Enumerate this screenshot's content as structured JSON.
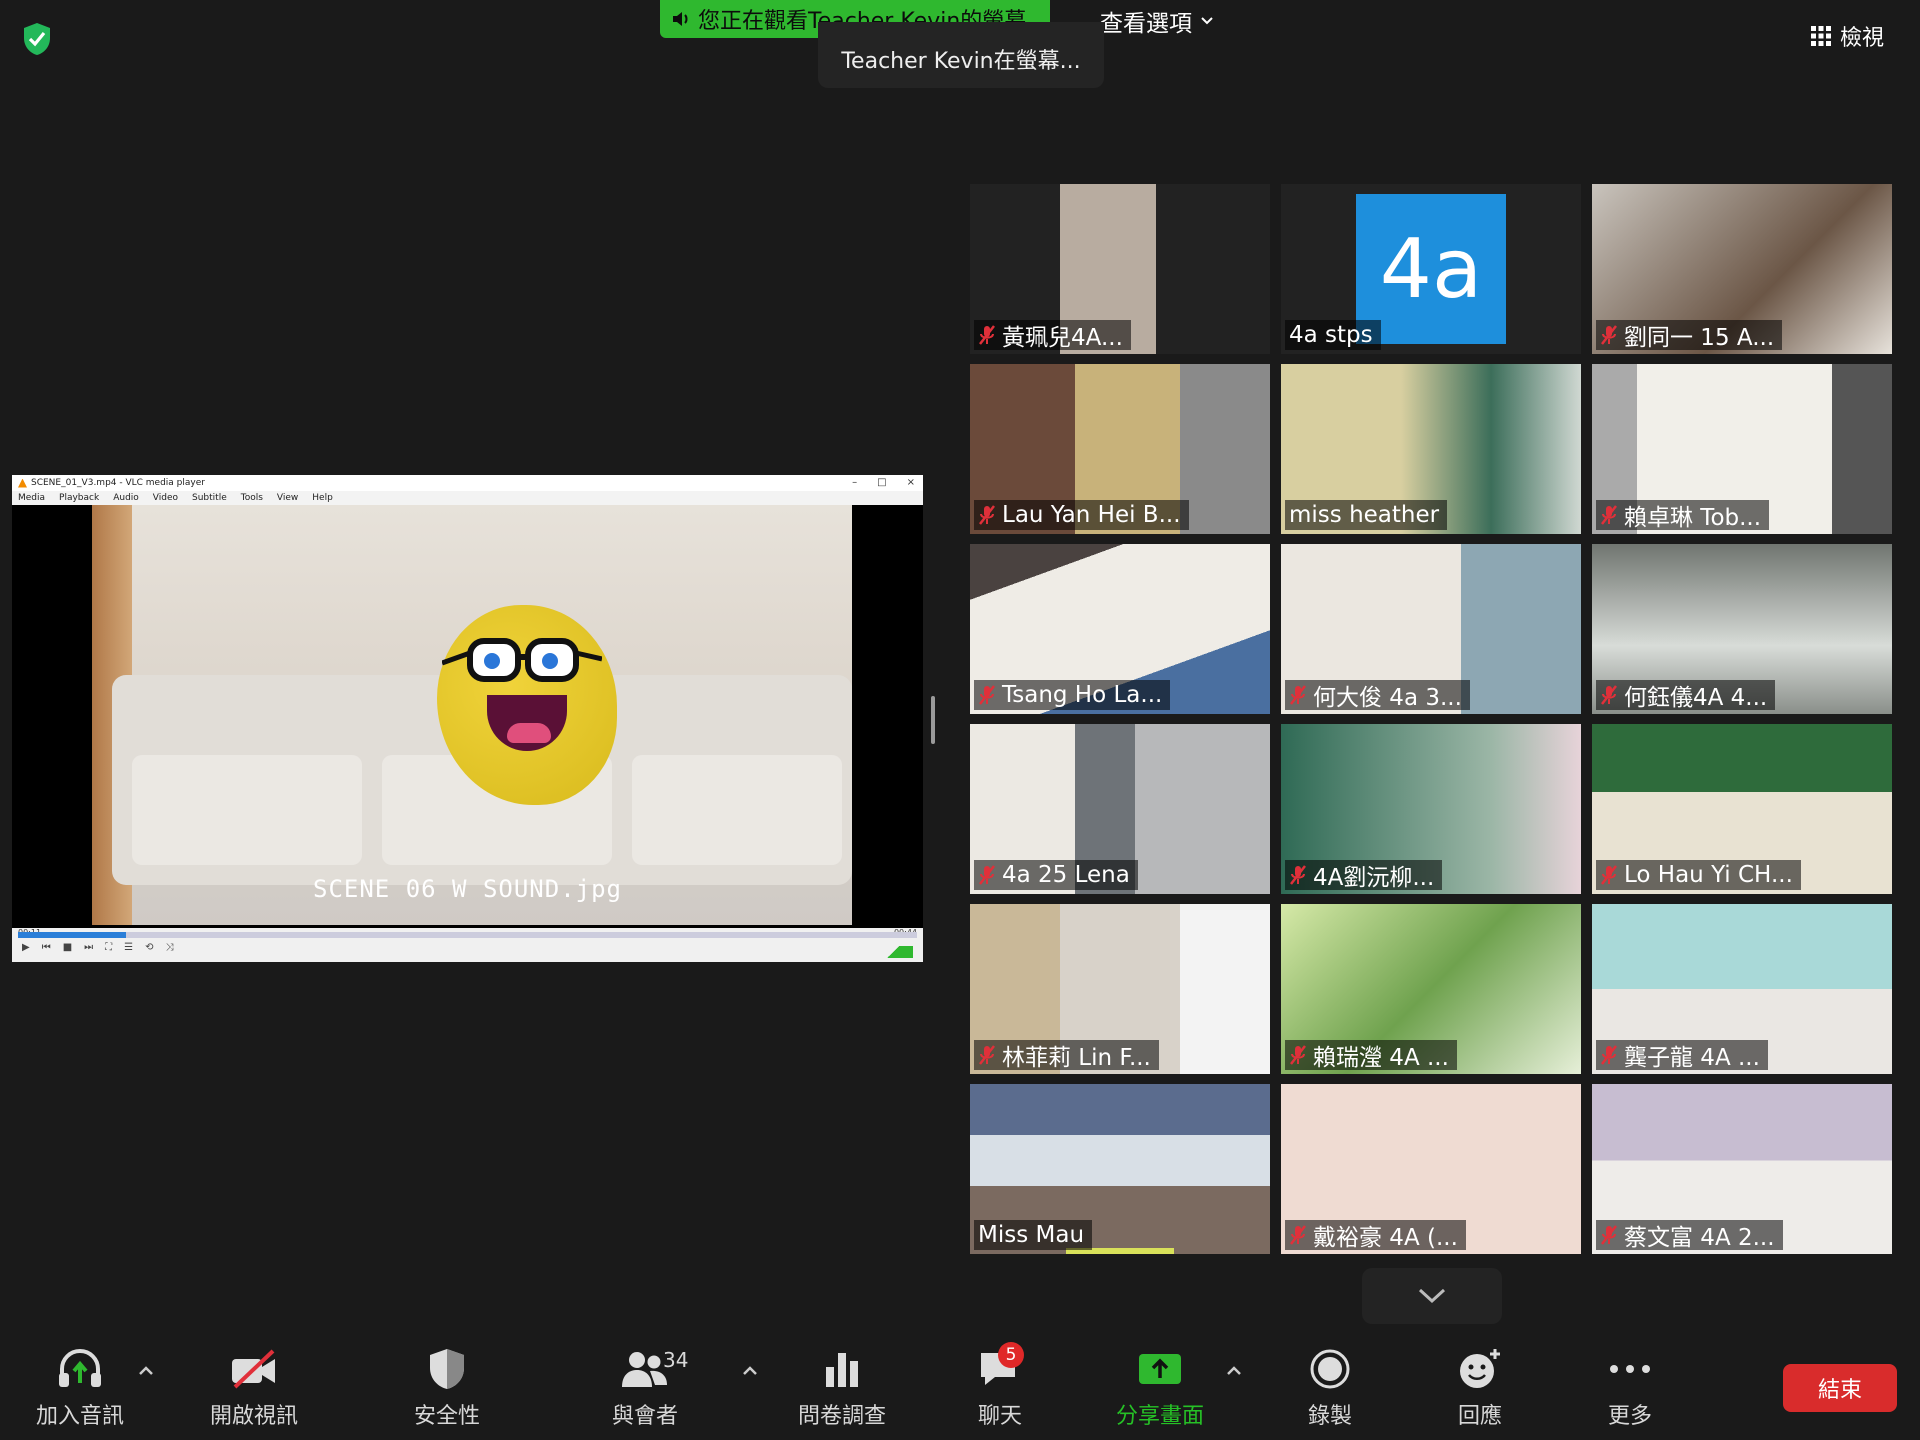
{
  "header": {
    "share_banner": "您正在觀看Teacher Kevin的螢幕",
    "view_options": "查看選項",
    "sharing_pill": "Teacher Kevin在螢幕...",
    "view_label": "檢視"
  },
  "shared_screen": {
    "title": "SCENE_01_V3.mp4 - VLC media player",
    "menu": [
      "Media",
      "Playback",
      "Audio",
      "Video",
      "Subtitle",
      "Tools",
      "View",
      "Help"
    ],
    "subtitle": "SCENE 06 W SOUND.jpg",
    "time_elapsed": "00:11",
    "time_total": "00:44",
    "progress": 0.12
  },
  "participants": [
    {
      "name": "黃珮兒4A...",
      "muted": true
    },
    {
      "name": "4a stps",
      "muted": false,
      "avatar_text": "4a"
    },
    {
      "name": "劉同一 15 A...",
      "muted": true
    },
    {
      "name": "Lau Yan Hei B...",
      "muted": true
    },
    {
      "name": "miss heather",
      "muted": false
    },
    {
      "name": "賴卓琳 Tob...",
      "muted": true
    },
    {
      "name": "Tsang Ho La...",
      "muted": true
    },
    {
      "name": "何大俊 4a 3...",
      "muted": true
    },
    {
      "name": "何鈺儀4A 4...",
      "muted": true
    },
    {
      "name": "4a 25 Lena",
      "muted": true
    },
    {
      "name": "4A劉沅柳...",
      "muted": true
    },
    {
      "name": "Lo Hau Yi CH...",
      "muted": true
    },
    {
      "name": "林菲莉 Lin F...",
      "muted": true
    },
    {
      "name": "賴瑞瀅 4A ...",
      "muted": true
    },
    {
      "name": "龔子龍 4A ...",
      "muted": true
    },
    {
      "name": "Miss Mau",
      "muted": false
    },
    {
      "name": "戴裕豪 4A (...",
      "muted": true
    },
    {
      "name": "蔡文富 4A 2...",
      "muted": true
    }
  ],
  "toolbar": {
    "join_audio": "加入音訊",
    "start_video": "開啟視訊",
    "security": "安全性",
    "participants": "與會者",
    "participants_count": "34",
    "polls": "問卷調查",
    "chat": "聊天",
    "chat_badge": "5",
    "share_screen": "分享畫面",
    "record": "錄製",
    "reactions": "回應",
    "more": "更多",
    "end": "結束"
  },
  "colors": {
    "share_green": "#2fb82f",
    "end_red": "#d92c2c",
    "avatar_blue": "#1e8fdc",
    "muted_red": "#e0303a",
    "active_speaker": "#d9e15a"
  }
}
